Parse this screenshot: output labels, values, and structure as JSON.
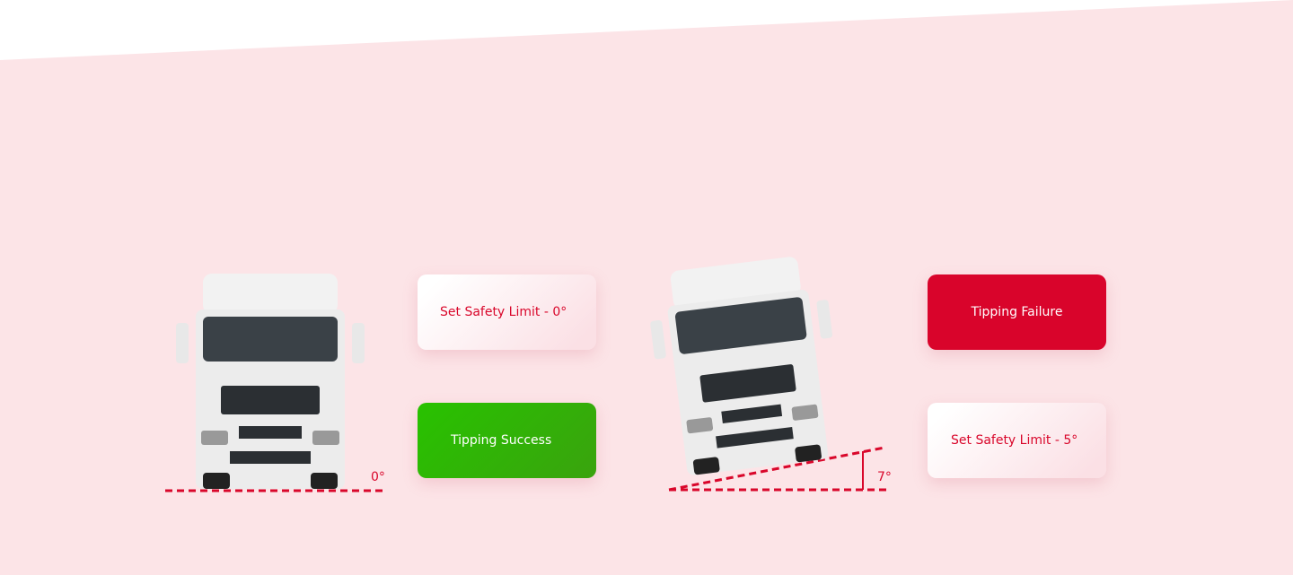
{
  "colors": {
    "background": "#fce4e7",
    "accent": "#d9072b",
    "success": "#2fb80a",
    "failure": "#d9042b"
  },
  "left_scenario": {
    "angle_label": "0°",
    "safety_card": "Set Safety Limit - 0°",
    "result_card": "Tipping Success"
  },
  "right_scenario": {
    "angle_label": "7°",
    "result_card": "Tipping Failure",
    "safety_card": "Set Safety Limit - 5°"
  }
}
